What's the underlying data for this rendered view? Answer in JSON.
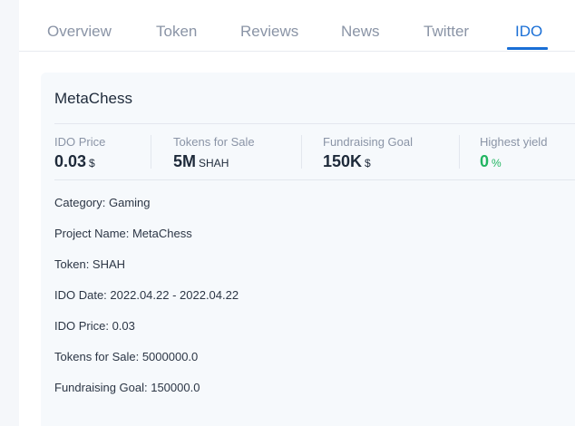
{
  "tabs": [
    {
      "label": "Overview",
      "active": false
    },
    {
      "label": "Token",
      "active": false
    },
    {
      "label": "Reviews",
      "active": false
    },
    {
      "label": "News",
      "active": false
    },
    {
      "label": "Twitter",
      "active": false
    },
    {
      "label": "IDO",
      "active": true
    }
  ],
  "project": {
    "name": "MetaChess"
  },
  "stats": [
    {
      "label": "IDO Price",
      "value": "0.03",
      "unit": "$"
    },
    {
      "label": "Tokens for Sale",
      "value": "5M",
      "unit": "SHAH"
    },
    {
      "label": "Fundraising Goal",
      "value": "150K",
      "unit": "$"
    },
    {
      "label": "Highest yield",
      "value": "0",
      "unit": "%"
    }
  ],
  "details": [
    "Category: Gaming",
    "Project Name: MetaChess",
    "Token: SHAH",
    "IDO Date: 2022.04.22 - 2022.04.22",
    "IDO Price: 0.03",
    "Tokens for Sale: 5000000.0",
    "Fundraising Goal: 150000.0"
  ],
  "colors": {
    "accent": "#1a6fd6",
    "positive": "#22b561"
  }
}
